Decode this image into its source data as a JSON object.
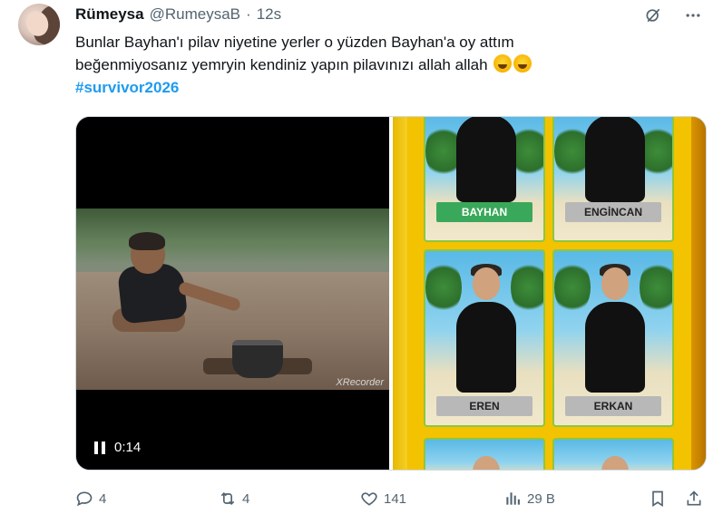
{
  "tweet": {
    "author_name": "Rümeysa",
    "author_handle": "@RumeysaB",
    "separator": "·",
    "time": "12s",
    "text_line1": "Bunlar Bayhan'ı pilav niyetine yerler o yüzden Bayhan'a oy attım",
    "text_line2": "beğenmiyosanız yemryin kendiniz yapın pilavınızı allah allah",
    "hashtag": "#survivor2026"
  },
  "video": {
    "elapsed": "0:14",
    "watermark": "XRecorder"
  },
  "collage": {
    "cards": [
      {
        "label": "BAYHAN",
        "highlight": true
      },
      {
        "label": "ENGİNCAN",
        "highlight": false
      },
      {
        "label": "EREN",
        "highlight": false
      },
      {
        "label": "ERKAN",
        "highlight": false
      }
    ]
  },
  "actions": {
    "replies": "4",
    "reposts": "4",
    "likes": "141",
    "views": "29 B"
  },
  "icons": {
    "reply": "reply-icon",
    "repost": "repost-icon",
    "like": "heart-icon",
    "views": "views-icon",
    "bookmark": "bookmark-icon",
    "share": "share-icon",
    "more": "more-icon",
    "grok": "grok-icon",
    "pause": "pause-icon"
  },
  "colors": {
    "accent": "#1d9bf0",
    "secondary_text": "#536471",
    "highlight_green": "#3aa85a"
  }
}
